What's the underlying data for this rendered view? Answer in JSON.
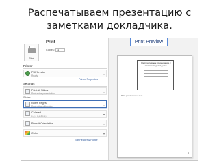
{
  "slide": {
    "title_line1": "Распечатываем презентацию с",
    "title_line2": "заметками докладчика."
  },
  "panel": {
    "print_title": "Print",
    "print_button_label": "Print",
    "copies_label": "Copies:",
    "copies_value": "1",
    "printer_section": "Printer",
    "printer_name": "PDFCreator",
    "printer_status": "Ready",
    "printer_properties_link": "Printer Properties",
    "settings_section": "Settings",
    "slides_range_title": "Print All Slides",
    "slides_range_sub": "Print entire presentation",
    "slides_label": "Slides:",
    "layout_title": "Notes Pages",
    "layout_sub": "Print slides with notes",
    "collate_title": "Collated",
    "collate_sub": "1,2,3   1,2,3   1,2,3",
    "orientation_title": "Portrait Orientation",
    "color_title": "Color",
    "edit_header_footer_link": "Edit Header & Footer"
  },
  "preview": {
    "badge": "Print Preview",
    "thumb_title": "Распечатываем презентацию с заметками докладчика.",
    "note_text": "Print preview notes text",
    "page_number": "4"
  },
  "colors": {
    "selection_border": "#3f6fb6",
    "badge_border": "#5b8bd8",
    "printer_ready": "#4da04d"
  }
}
